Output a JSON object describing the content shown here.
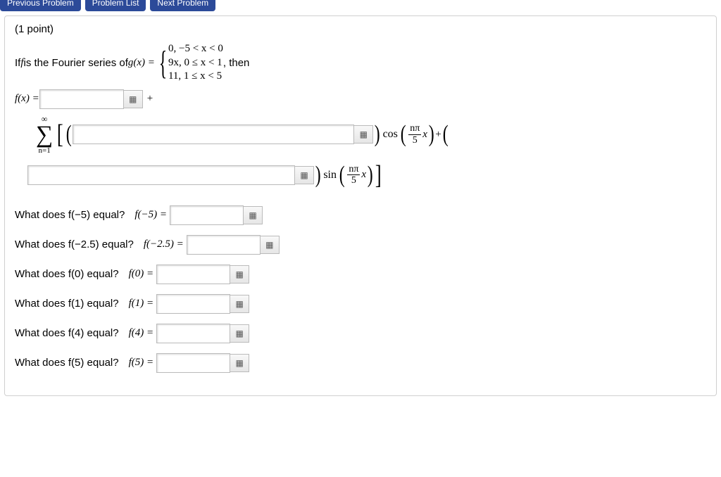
{
  "nav": {
    "prev": "Previous Problem",
    "list": "Problem List",
    "next": "Next Problem"
  },
  "points": "(1 point)",
  "intro": {
    "pre": "If ",
    "f": "f",
    "mid": " is the Fourier series of ",
    "g": "g(x) = ",
    "then": " ,  then"
  },
  "piecewise": {
    "r1": "0,     −5 < x < 0",
    "r2": "9x,    0 ≤ x < 1",
    "r3": "11,    1 ≤ x < 5"
  },
  "fx_label": "f(x) = ",
  "plus": " + ",
  "sigma": {
    "top": "∞",
    "bot": "n=1"
  },
  "cos": "cos",
  "sin": "sin",
  "frac": {
    "num": "nπ",
    "den": "5",
    "var": "x"
  },
  "questions": [
    {
      "label": "What does f(−5) equal?",
      "eq": "f(−5) ="
    },
    {
      "label": "What does f(−2.5) equal?",
      "eq": "f(−2.5) ="
    },
    {
      "label": "What does f(0) equal?",
      "eq": "f(0) ="
    },
    {
      "label": "What does f(1) equal?",
      "eq": "f(1) ="
    },
    {
      "label": "What does f(4) equal?",
      "eq": "f(4) ="
    },
    {
      "label": "What does f(5) equal?",
      "eq": "f(5) ="
    }
  ]
}
